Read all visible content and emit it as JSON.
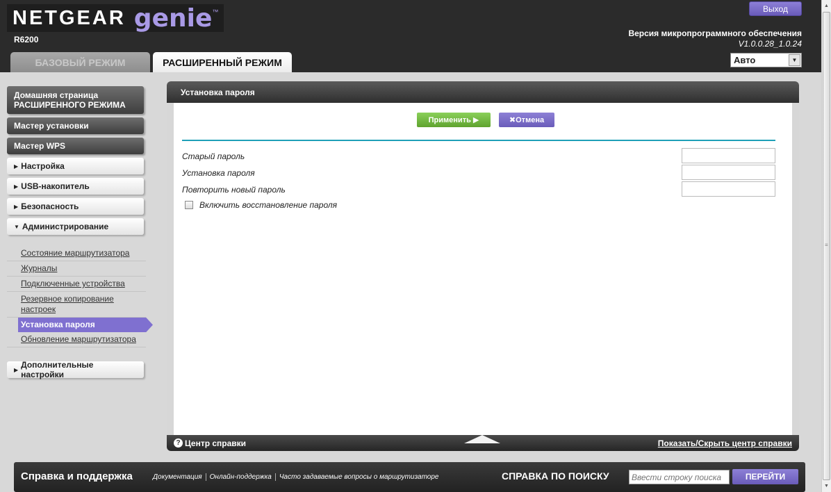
{
  "header": {
    "logo_netgear": "NETGEAR",
    "logo_genie": "genie",
    "logo_tm": "™",
    "model": "R6200",
    "logout_label": "Выход",
    "firmware_label": "Версия микропрограммного обеспечения",
    "firmware_version": "V1.0.0.28_1.0.24",
    "language_selected": "Авто",
    "tabs": [
      {
        "label": "БАЗОВЫЙ РЕЖИМ",
        "active": false
      },
      {
        "label": "РАСШИРЕННЫЙ РЕЖИМ",
        "active": true
      }
    ]
  },
  "sidebar": {
    "home_line1": "Домашняя страница",
    "home_line2": "РАСШИРЕННОГО РЕЖИМА",
    "setup_wizard": "Мастер установки",
    "wps_wizard": "Мастер WPS",
    "sections": [
      {
        "label": "Настройка"
      },
      {
        "label": "USB-накопитель"
      },
      {
        "label": "Безопасность"
      },
      {
        "label": "Администрирование"
      }
    ],
    "admin_items": [
      {
        "label": "Состояние маршрутизатора"
      },
      {
        "label": "Журналы"
      },
      {
        "label": "Подключенные устройства"
      },
      {
        "label": "Резервное копирование настроек"
      },
      {
        "label": "Установка пароля",
        "active": true
      },
      {
        "label": "Обновление маршрутизатора"
      }
    ],
    "advanced_settings": "Дополнительные настройки"
  },
  "panel": {
    "title": "Установка пароля",
    "apply_label": "Применить ▶",
    "cancel_label": "✖Отмена",
    "fields": [
      {
        "label": "Старый пароль",
        "value": ""
      },
      {
        "label": "Установка пароля",
        "value": ""
      },
      {
        "label": "Повторить новый пароль",
        "value": ""
      }
    ],
    "recovery_label": "Включить восстановление пароля",
    "recovery_checked": false,
    "help_icon": "?",
    "help_center": "Центр справки",
    "toggle_help": "Показать/Скрыть центр справки"
  },
  "bottom": {
    "support_title": "Справка и поддержка",
    "links": [
      "Документация",
      "Онлайн-поддержка",
      "Часто задаваемые вопросы о маршрутизаторе"
    ],
    "search_title": "СПРАВКА ПО ПОИСКУ",
    "search_placeholder": "Ввести строку поиска",
    "go_label": "ПЕРЕЙТИ"
  },
  "colors": {
    "accent_purple": "#7f70d0",
    "apply_green": "#6fba3e",
    "divider_teal": "#1fa0b8"
  }
}
